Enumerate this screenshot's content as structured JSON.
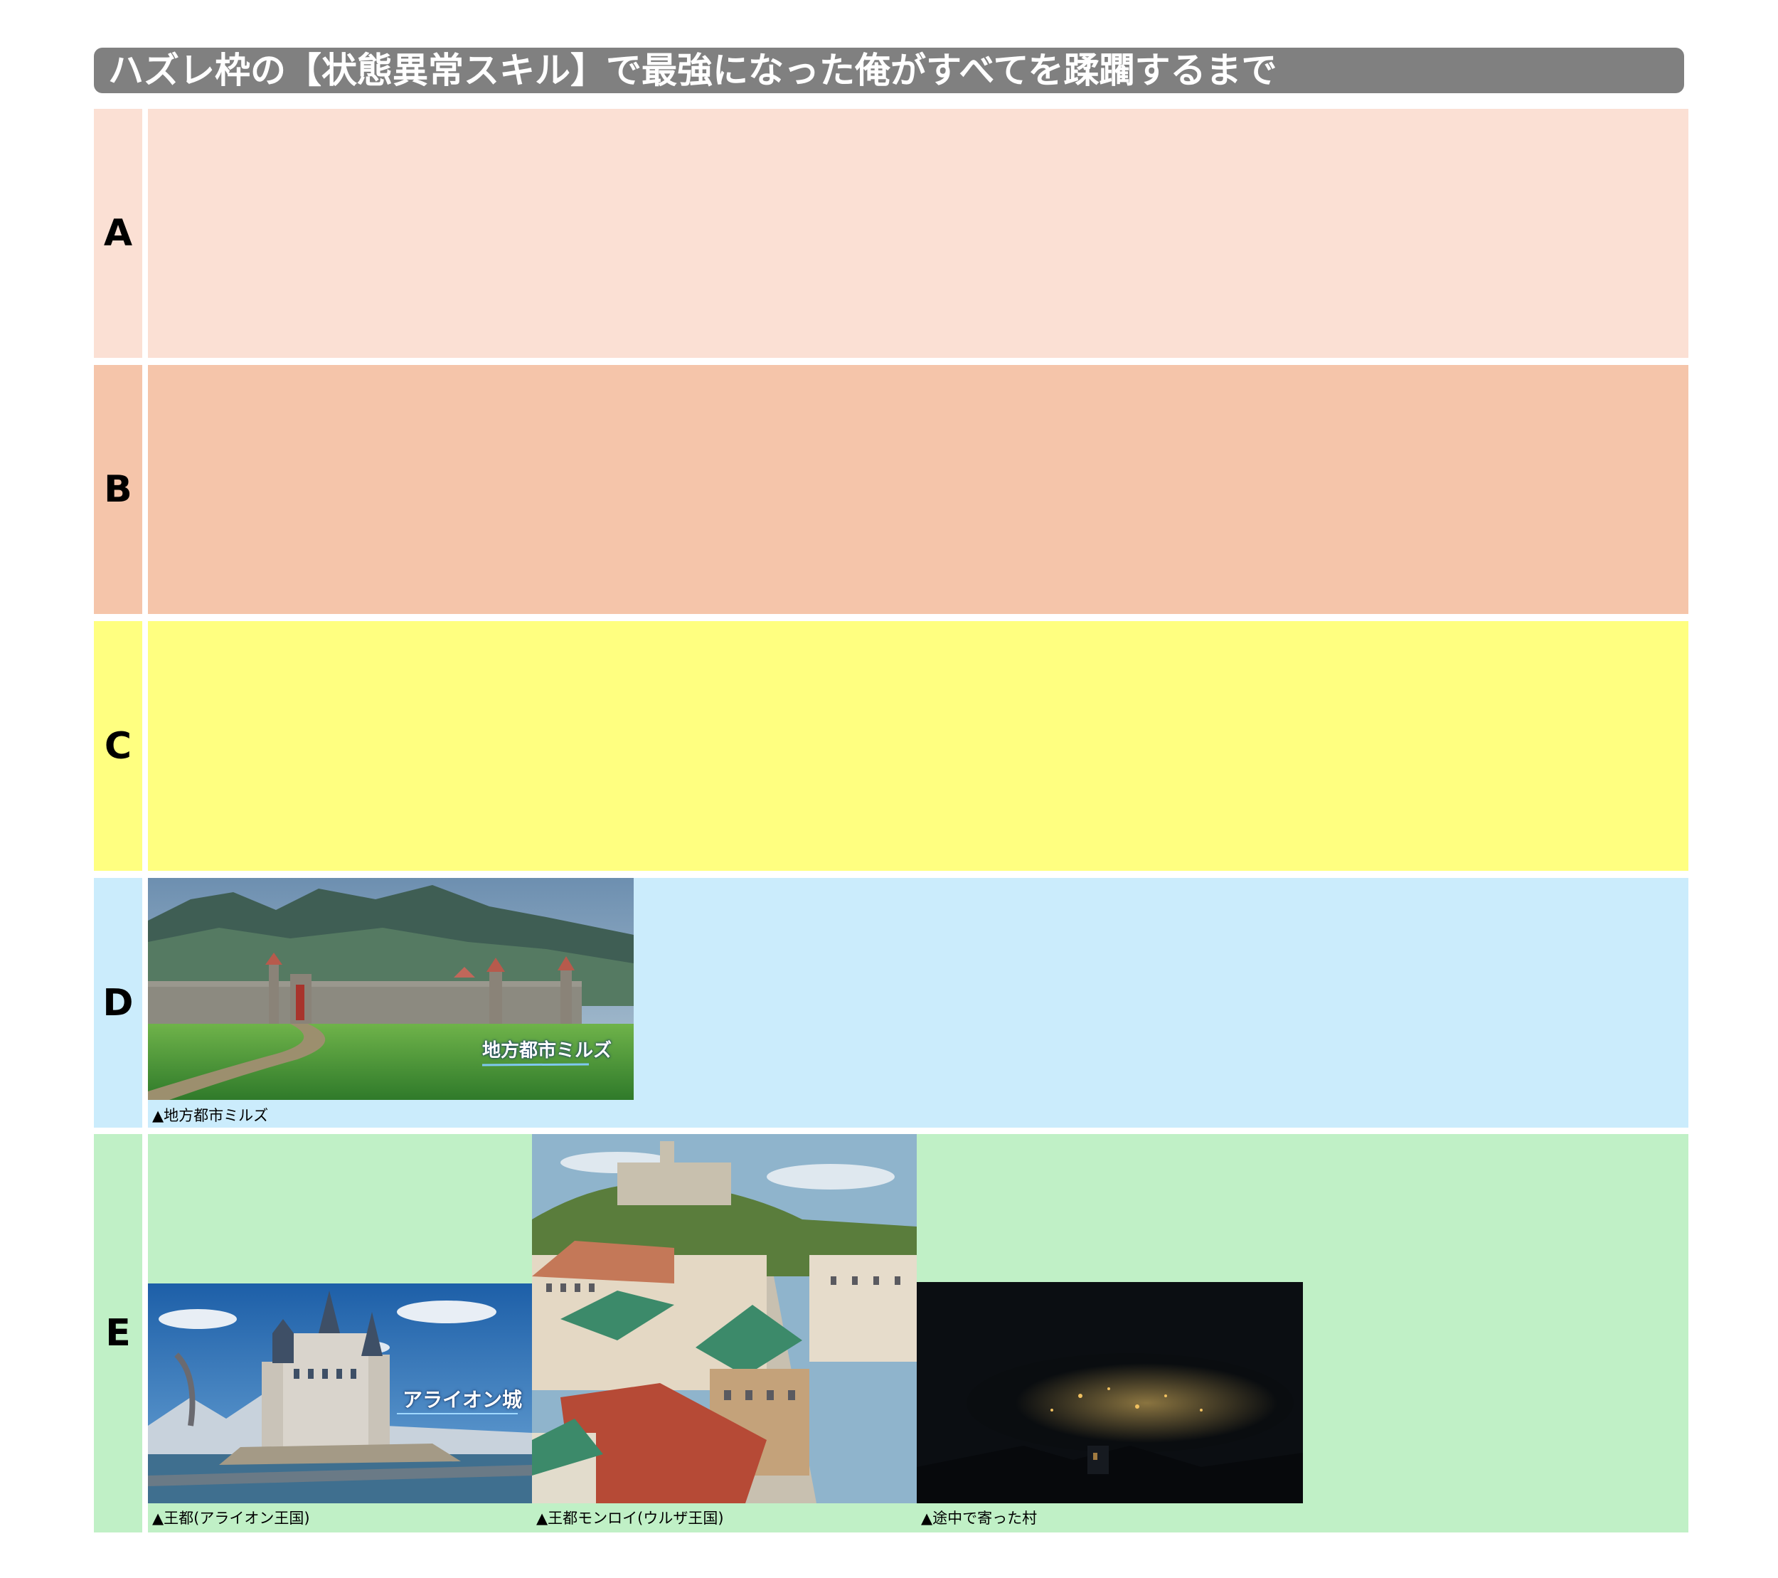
{
  "title": "ハズレ枠の【状態異常スキル】で最強になった俺がすべてを蹂躙するまで",
  "tiers": [
    {
      "label": "A",
      "color": "#fbe0d4"
    },
    {
      "label": "B",
      "color": "#f5c5aa"
    },
    {
      "label": "C",
      "color": "#ffff80"
    },
    {
      "label": "D",
      "color": "#cbecfc"
    },
    {
      "label": "E",
      "color": "#c0f0c6"
    }
  ],
  "items": {
    "d1": {
      "caption": "▲地方都市ミルズ",
      "overlay": "地方都市ミルズ",
      "image": "walled-town-landscape"
    },
    "e1": {
      "caption": "▲王都(アライオン王国)",
      "overlay": "アライオン城",
      "image": "castle-landscape"
    },
    "e2": {
      "caption": "▲王都モンロイ(ウルザ王国)",
      "image": "city-street-view"
    },
    "e3": {
      "caption": "▲途中で寄った村",
      "image": "night-village"
    }
  }
}
